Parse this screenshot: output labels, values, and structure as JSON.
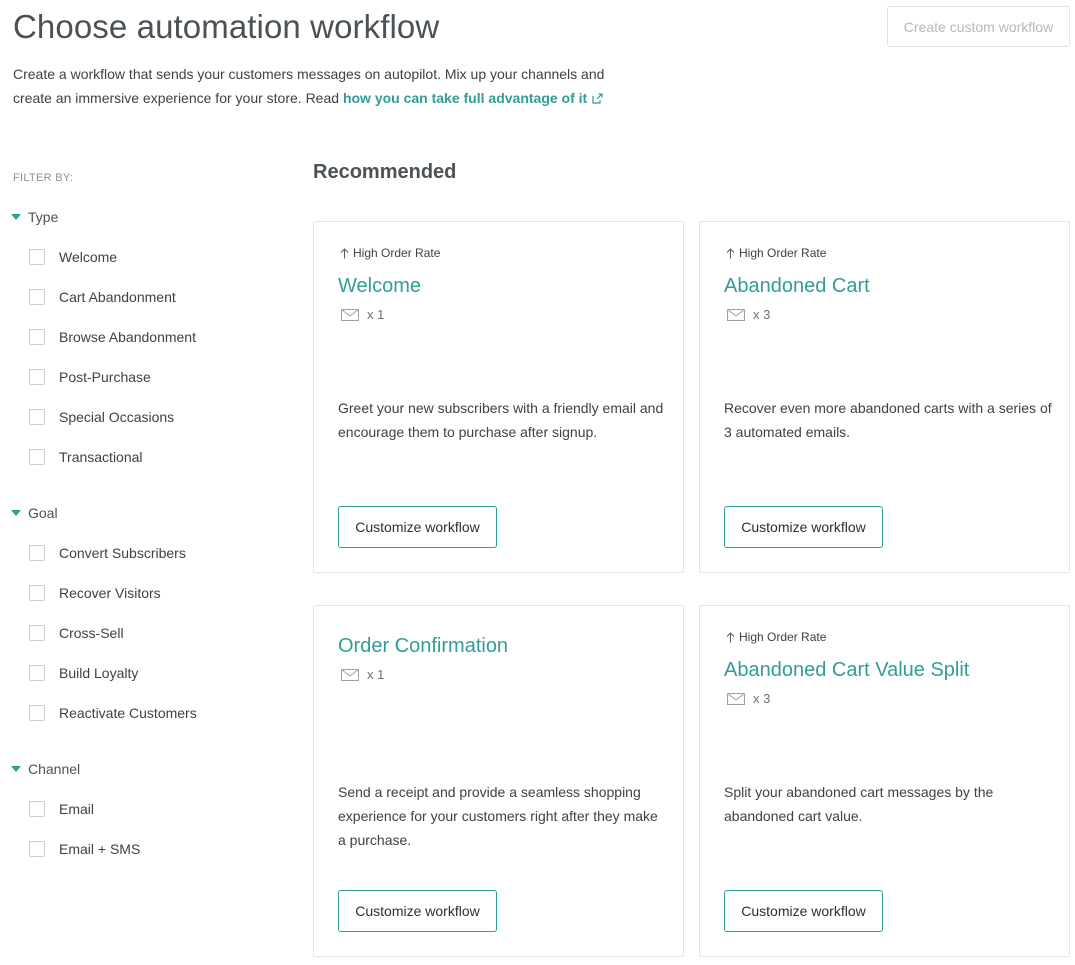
{
  "header": {
    "title": "Choose automation workflow",
    "create_button": "Create custom workflow",
    "intro_text": "Create a workflow that sends your customers messages on autopilot. Mix up your channels and create an immersive experience for your store. Read ",
    "intro_link": "how you can take full advantage of it",
    "link_icon": "external-link-icon"
  },
  "sidebar": {
    "filter_label": "FILTER BY:",
    "groups": [
      {
        "label": "Type",
        "options": [
          "Welcome",
          "Cart Abandonment",
          "Browse Abandonment",
          "Post-Purchase",
          "Special Occasions",
          "Transactional"
        ]
      },
      {
        "label": "Goal",
        "options": [
          "Convert Subscribers",
          "Recover Visitors",
          "Cross-Sell",
          "Build Loyalty",
          "Reactivate Customers"
        ]
      },
      {
        "label": "Channel",
        "options": [
          "Email",
          "Email + SMS"
        ]
      }
    ]
  },
  "main": {
    "section_title": "Recommended",
    "cards": [
      {
        "badge": "High Order Rate",
        "title": "Welcome",
        "count": "x 1",
        "description": "Greet your new subscribers with a friendly email and encourage them to purchase after signup.",
        "button": "Customize workflow"
      },
      {
        "badge": "High Order Rate",
        "title": "Abandoned Cart",
        "count": "x 3",
        "description": "Recover even more abandoned carts with a series of 3 automated emails.",
        "button": "Customize workflow"
      },
      {
        "badge": "",
        "title": "Order Confirmation",
        "count": "x 1",
        "description": "Send a receipt and provide a seamless shopping experience for your customers right after they make a purchase.",
        "button": "Customize workflow"
      },
      {
        "badge": "High Order Rate",
        "title": "Abandoned Cart Value Split",
        "count": "x 3",
        "description": "Split your abandoned cart messages by the abandoned cart value.",
        "button": "Customize workflow"
      }
    ]
  },
  "colors": {
    "accent": "#2f9e96",
    "text": "#3c4247",
    "border": "#e3e6e8"
  }
}
